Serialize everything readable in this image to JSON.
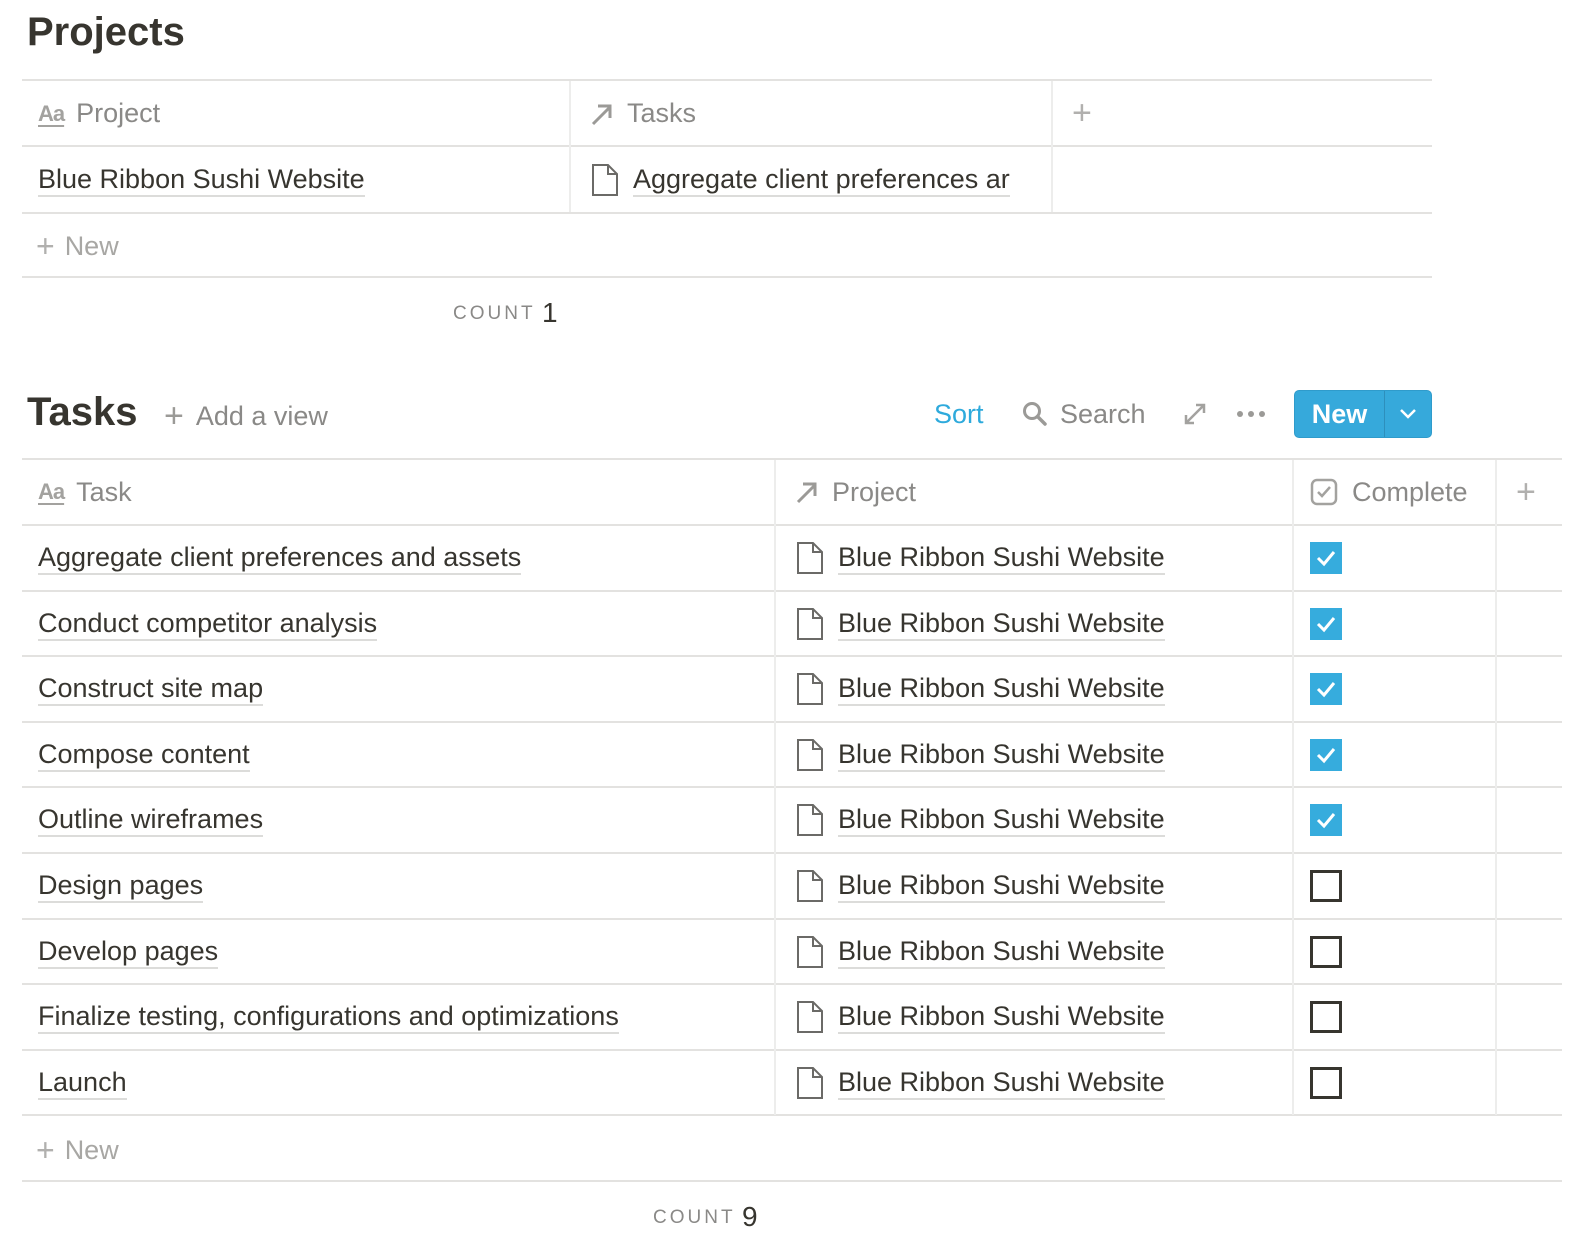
{
  "projects": {
    "title": "Projects",
    "columns": [
      {
        "label": "Project",
        "icon": "text-aa-icon"
      },
      {
        "label": "Tasks",
        "icon": "relation-arrow-icon"
      }
    ],
    "add_column_icon": "plus-icon",
    "rows": [
      {
        "project": "Blue Ribbon Sushi Website",
        "tasks": "Aggregate client preferences ar"
      }
    ],
    "new_label": "New",
    "count_label": "COUNT",
    "count_value": "1"
  },
  "tasks": {
    "title": "Tasks",
    "add_view_label": "Add a view",
    "toolbar": {
      "sort_label": "Sort",
      "search_label": "Search",
      "expand_icon": "expand-arrows-icon",
      "more_icon": "ellipsis-icon",
      "new_label": "New",
      "new_dropdown_icon": "chevron-down-icon"
    },
    "accent_color": "#2eaadc",
    "columns": [
      {
        "label": "Task",
        "icon": "text-aa-icon"
      },
      {
        "label": "Project",
        "icon": "relation-arrow-icon"
      },
      {
        "label": "Complete",
        "icon": "checkbox-icon"
      }
    ],
    "rows": [
      {
        "task": "Aggregate client preferences and assets",
        "project": "Blue Ribbon Sushi Website",
        "complete": true
      },
      {
        "task": "Conduct competitor analysis",
        "project": "Blue Ribbon Sushi Website",
        "complete": true
      },
      {
        "task": "Construct site map",
        "project": "Blue Ribbon Sushi Website",
        "complete": true
      },
      {
        "task": "Compose content",
        "project": "Blue Ribbon Sushi Website",
        "complete": true
      },
      {
        "task": "Outline wireframes",
        "project": "Blue Ribbon Sushi Website",
        "complete": true
      },
      {
        "task": "Design pages",
        "project": "Blue Ribbon Sushi Website",
        "complete": false
      },
      {
        "task": "Develop pages",
        "project": "Blue Ribbon Sushi Website",
        "complete": false
      },
      {
        "task": "Finalize testing, configurations and optimizations",
        "project": "Blue Ribbon Sushi Website",
        "complete": false
      },
      {
        "task": "Launch",
        "project": "Blue Ribbon Sushi Website",
        "complete": false
      }
    ],
    "new_label": "New",
    "count_label": "COUNT",
    "count_value": "9"
  }
}
